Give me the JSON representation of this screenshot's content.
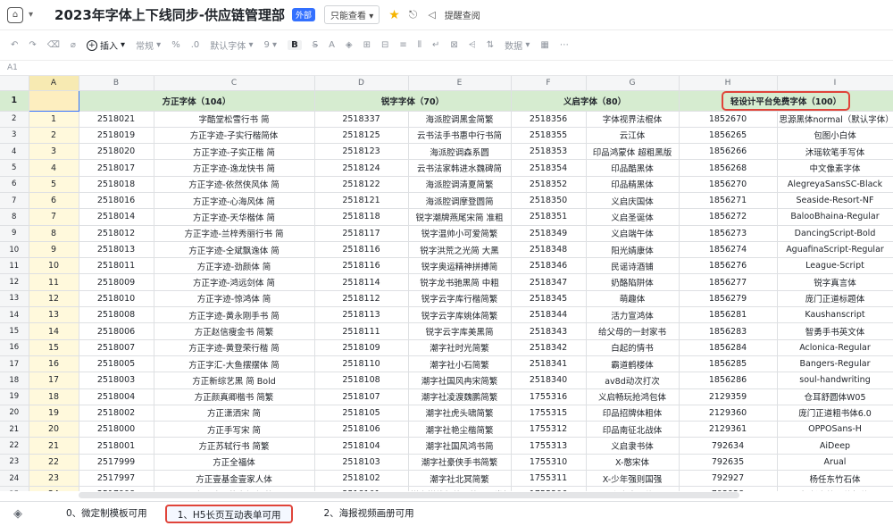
{
  "titlebar": {
    "title": "2023年字体上下线同步-供应链管理部",
    "badge": "外部",
    "mode": "只能查看",
    "mode_caret": "▾",
    "remind": "提醒查阅"
  },
  "toolbar": {
    "insert": "插入",
    "format": "常规",
    "font": "默认字体",
    "size": "9",
    "bold": "B",
    "data": "数据",
    "caret": "▾"
  },
  "formula": {
    "cellref": "A1"
  },
  "columns": [
    "",
    "A",
    "B",
    "C",
    "D",
    "E",
    "F",
    "G",
    "H",
    "I"
  ],
  "header_row": {
    "num": "1",
    "a": "",
    "g1": "方正字体（104）",
    "g2": "锐字字体（70）",
    "g3": "义启字体（80）",
    "g4": "轻设计平台免费字体（100）"
  },
  "rows": [
    [
      "2",
      "1",
      "2518021",
      "字酷堂松雪行书 简",
      "2518337",
      "海派腔调黑金简繁",
      "2518356",
      "字体视界法棍体",
      "1852670",
      "思源黑体normal（默认字体）"
    ],
    [
      "3",
      "2",
      "2518019",
      "方正字迹-子实行楷简体",
      "2518125",
      "云书法手书惠中行书简",
      "2518355",
      "云江体",
      "1856265",
      "包图小白体"
    ],
    [
      "4",
      "3",
      "2518020",
      "方正字迹-子实正楷 简",
      "2518123",
      "海派腔调森系圆",
      "2518353",
      "印品鸿蒙体 超粗黑版",
      "1856266",
      "沐瑶软笔手写体"
    ],
    [
      "5",
      "4",
      "2518017",
      "方正字迹-逸龙快书 简",
      "2518124",
      "云书法家韩进水魏碑简",
      "2518354",
      "印品酷黑体",
      "1856268",
      "中文像素字体"
    ],
    [
      "6",
      "5",
      "2518018",
      "方正字迹-依然侠风体 简",
      "2518122",
      "海派腔调清夏简繁",
      "2518352",
      "印品精黑体",
      "1856270",
      "AlegreyaSansSC-Black"
    ],
    [
      "7",
      "6",
      "2518016",
      "方正字迹-心海风体 简",
      "2518121",
      "海派腔调摩登圆简",
      "2518350",
      "义启庆国体",
      "1856271",
      "Seaside-Resort-NF"
    ],
    [
      "8",
      "7",
      "2518014",
      "方正字迹-天华楷体 简",
      "2518118",
      "锐字潮牌燕尾宋简 准粗",
      "2518351",
      "义启圣诞体",
      "1856272",
      "BalooBhaina-Regular"
    ],
    [
      "9",
      "8",
      "2518012",
      "方正字迹-兰梓秀丽行书 简",
      "2518117",
      "锐字温帅小可爱简繁",
      "2518349",
      "义启端午体",
      "1856273",
      "DancingScript-Bold"
    ],
    [
      "10",
      "9",
      "2518013",
      "方正字迹-仝斌飘逸体 简",
      "2518116",
      "锐字洪荒之光简 大黑",
      "2518348",
      "阳光婧康体",
      "1856274",
      "AguafinaScript-Regular"
    ],
    [
      "11",
      "10",
      "2518011",
      "方正字迹-劲颜体 简",
      "2518116",
      "锐字奥运精神拼搏简",
      "2518346",
      "民谣诗酒铺",
      "1856276",
      "League-Script"
    ],
    [
      "12",
      "11",
      "2518009",
      "方正字迹-鸿远剑体 简",
      "2518114",
      "锐字龙书驰黑简 中粗",
      "2518347",
      "奶酪陷阱体",
      "1856277",
      "锐字真言体"
    ],
    [
      "13",
      "12",
      "2518010",
      "方正字迹-惊鸿体 简",
      "2518112",
      "锐字云字库行楷简繁",
      "2518345",
      "萌趣体",
      "1856279",
      "庞门正道标题体"
    ],
    [
      "14",
      "13",
      "2518008",
      "方正字迹-黄永刚手书 简",
      "2518113",
      "锐字云字库姚体简繁",
      "2518344",
      "活力宣鸿体",
      "1856281",
      "Kaushanscript"
    ],
    [
      "15",
      "14",
      "2518006",
      "方正赵信瘦金书 简繁",
      "2518111",
      "锐字云字库美黑简",
      "2518343",
      "给父母的一封家书",
      "1856283",
      "智勇手书英文体"
    ],
    [
      "16",
      "15",
      "2518007",
      "方正字迹-黄登荣行楷 简",
      "2518109",
      "潮字社时光简繁",
      "2518342",
      "白起的情书",
      "1856284",
      "Aclonica-Regular"
    ],
    [
      "17",
      "16",
      "2518005",
      "方正字汇-大鱼摆摆体 简",
      "2518110",
      "潮字社小石简繁",
      "2518341",
      "霸道鹤楼体",
      "1856285",
      "Bangers-Regular"
    ],
    [
      "18",
      "17",
      "2518003",
      "方正新综艺黑 简 Bold",
      "2518108",
      "潮字社国风冉宋简繁",
      "2518340",
      "av8d动次打次",
      "1856286",
      "soul-handwriting"
    ],
    [
      "19",
      "18",
      "2518004",
      "方正颜真卿楷书 简繁",
      "2518107",
      "潮字社凌渡魏鹏简繁",
      "1755316",
      "义启畅玩抢鸿包体",
      "2129359",
      "仓耳舒圆体W05"
    ],
    [
      "20",
      "19",
      "2518002",
      "方正潇洒宋 简",
      "2518105",
      "潮字社虎头啸简繁",
      "1755315",
      "印品招牌体粗体",
      "2129360",
      "庞门正道粗书体6.0"
    ],
    [
      "21",
      "20",
      "2518000",
      "方正手写宋 简",
      "2518106",
      "潮字社艳尘楷简繁",
      "1755312",
      "印品南征北战体",
      "2129361",
      "OPPOSans-H"
    ],
    [
      "22",
      "21",
      "2518001",
      "方正苏轼行书 简繁",
      "2518104",
      "潮字社国风鸿书简",
      "1755313",
      "义启隶书体",
      "792634",
      "AiDeep"
    ],
    [
      "23",
      "22",
      "2517999",
      "方正全福体",
      "2518103",
      "潮字社豪侠手书简繁",
      "1755310",
      "X-憨宋体",
      "792635",
      "Arual"
    ],
    [
      "24",
      "23",
      "2517997",
      "方正壹基金壹家人体",
      "2518102",
      "潮字社北冥简繁",
      "1755311",
      "X-少年强则国强",
      "792927",
      "杨任东竹石体"
    ],
    [
      "25",
      "24",
      "2517998",
      "方正欧阳荷庚行书 简",
      "2518101",
      "锐字锐线怒放黑简1.0 常规",
      "1755306",
      "义启中圆体",
      "792928",
      "杨任东竹石体粗体"
    ],
    [
      "26",
      "25",
      "2517995",
      "方正华思经宋 简",
      "2518100",
      "汉字之美玉龙简",
      "1755307",
      "我愿为你所向披靡",
      "792931",
      "杨任东竹石体细体"
    ],
    [
      "27",
      "26",
      "2517996",
      "",
      "2518099",
      "",
      "1755308",
      "",
      "792932",
      "站酷高端黑"
    ]
  ],
  "tabs": [
    "0、微定制模板可用",
    "1、H5长页互动表单可用",
    "2、海报视频画册可用"
  ]
}
